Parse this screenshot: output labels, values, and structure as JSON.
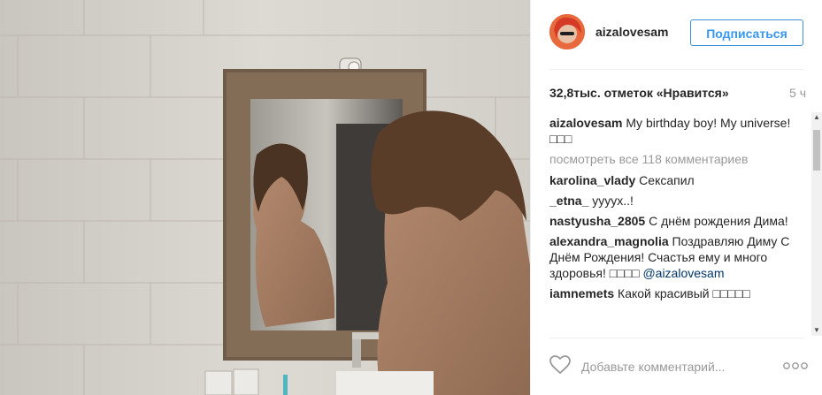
{
  "post": {
    "username": "aizalovesam",
    "follow_label": "Подписаться",
    "likes": "32,8тыс. отметок «Нравится»",
    "time": "5 ч"
  },
  "caption": {
    "user": "aizalovesam",
    "text": "My birthday boy! My universe! □□□"
  },
  "view_all": "посмотреть все 118 комментариев",
  "comments": [
    {
      "user": "karolina_vlady",
      "text": "Сексапил"
    },
    {
      "user": "_etna_",
      "text": "ууууx..!"
    },
    {
      "user": "nastyusha_2805",
      "text": "С днём рождения Дима!"
    },
    {
      "user": "alexandra_magnolia",
      "text": "Поздравляю Диму С Днём Рождения! Счастья ему и много здоровья! □□□□",
      "mention": "@aizalovesam"
    },
    {
      "user": "iamnemets",
      "text": "Какой красивый □□□□□"
    }
  ],
  "add_comment": {
    "placeholder": "Добавьте комментарий..."
  },
  "colors": {
    "accent": "#3897f0",
    "muted": "#999999",
    "text": "#262626"
  },
  "icons": [
    "heart-icon",
    "more-options-icon",
    "scroll-up-arrow",
    "scroll-down-arrow"
  ]
}
